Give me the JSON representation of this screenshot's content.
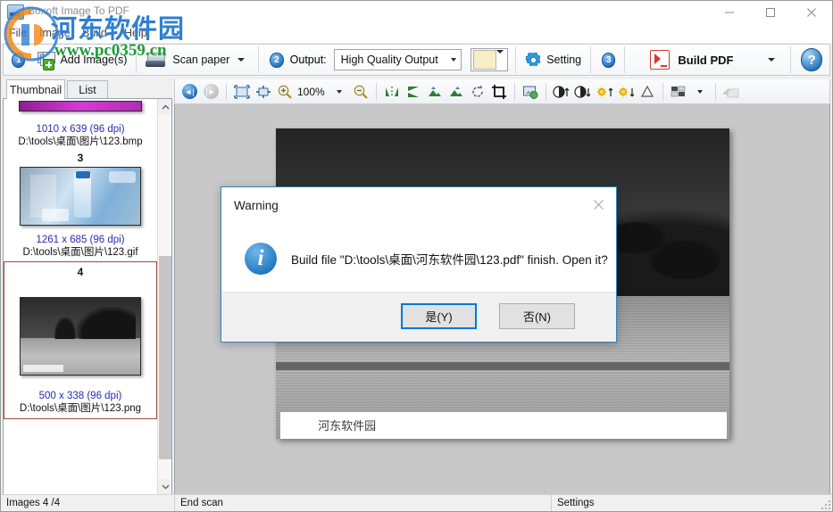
{
  "window": {
    "title": "Boxoft Image To PDF",
    "controls": {
      "minimize": "–",
      "maximize": "□",
      "close": "✕"
    }
  },
  "menubar": {
    "items": [
      {
        "label": "File"
      },
      {
        "label": "Image"
      },
      {
        "label": "Build"
      },
      {
        "label": "Help"
      }
    ]
  },
  "toolbar": {
    "step1_badge": "1",
    "add_images_label": "Add Image(s)",
    "scan_paper_label": "Scan paper",
    "step2_badge": "2",
    "output_label": "Output:",
    "output_value": "High Quality Output",
    "output_options": [
      "High Quality Output"
    ],
    "swatch_color": "#f7eec9",
    "setting_label": "Setting",
    "step3_badge": "3",
    "build_pdf_label": "Build PDF",
    "help_label": "?"
  },
  "viewtoolbar": {
    "zoom_value": "100%",
    "icons": [
      "first-page-icon",
      "last-page-icon",
      "fit-page-icon",
      "fit-width-icon",
      "zoom-in-icon",
      "zoom-out-icon",
      "flip-horizontal-icon",
      "flip-vertical-icon",
      "rotate-left-icon",
      "rotate-right-icon",
      "rotate-icon",
      "crop-icon",
      "refresh-image-icon",
      "contrast-up-icon",
      "contrast-down-icon",
      "brightness-up-icon",
      "brightness-down-icon",
      "gamma-icon",
      "layout-icon",
      "undo-icon"
    ]
  },
  "leftpanel": {
    "tabs": [
      {
        "label": "Thumbnail",
        "active": true
      },
      {
        "label": "List",
        "active": false
      }
    ],
    "items": [
      {
        "index": "",
        "resolution": "1010 x 639 (96 dpi)",
        "path": "D:\\tools\\桌面\\图片\\123.bmp",
        "selected": false
      },
      {
        "index": "3",
        "resolution": "1261 x 685 (96 dpi)",
        "path": "D:\\tools\\桌面\\图片\\123.gif",
        "selected": false
      },
      {
        "index": "4",
        "resolution": "500 x 338 (96 dpi)",
        "path": "D:\\tools\\桌面\\图片\\123.png",
        "selected": true
      }
    ]
  },
  "preview": {
    "overlay_text": "河东软件园"
  },
  "dialog": {
    "title": "Warning",
    "close": "✕",
    "icon": "i",
    "message": "Build file \"D:\\tools\\桌面\\河东软件园\\123.pdf\" finish. Open it?",
    "yes_label": "是(Y)",
    "no_label": "否(N)"
  },
  "statusbar": {
    "images": "Images 4 /4",
    "scan": "End scan",
    "settings": "Settings"
  },
  "watermark": {
    "cn": "河东软件园",
    "url": "www.pc0359.cn"
  }
}
